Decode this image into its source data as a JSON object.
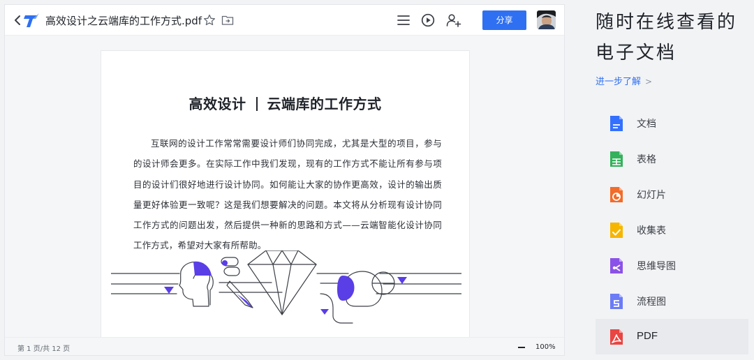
{
  "viewer": {
    "title": "高效设计之云端库的工作方式.pdf",
    "share_label": "分享",
    "icons": [
      "back-icon",
      "app-logo",
      "star-icon",
      "move-to-folder-icon",
      "menu-icon",
      "play-icon",
      "add-user-icon"
    ]
  },
  "document": {
    "heading_left": "高效设计",
    "heading_right": "云端库的工作方式",
    "body": "互联网的设计工作常常需要设计师们协同完成，尤其是大型的项目，参与的设计师会更多。在实际工作中我们发现，现有的工作方式不能让所有参与项目的设计们很好地进行设计协同。如何能让大家的协作更高效，设计的输出质量更好体验更一致呢？这是我们想要解决的问题。本文将从分析现有设计协同工作方式的问题出发，然后提供一种新的思路和方式——云端智能化设计协同工作方式，希望对大家有所帮助。"
  },
  "status": {
    "page_indicator": "第 1 页/共 12 页",
    "zoom": "100%"
  },
  "promo": {
    "title": "随时在线查看的电子文档",
    "learn_more": "进一步了解",
    "learn_more_chevron": ">"
  },
  "file_types": [
    {
      "label": "文档",
      "icon": "doc-icon",
      "color": "#3370ff"
    },
    {
      "label": "表格",
      "icon": "sheet-icon",
      "color": "#34b15c"
    },
    {
      "label": "幻灯片",
      "icon": "slides-icon",
      "color": "#f26c2a"
    },
    {
      "label": "收集表",
      "icon": "form-icon",
      "color": "#f6b600"
    },
    {
      "label": "思维导图",
      "icon": "mindmap-icon",
      "color": "#8a52e8"
    },
    {
      "label": "流程图",
      "icon": "flowchart-icon",
      "color": "#6b7cf6"
    },
    {
      "label": "PDF",
      "icon": "pdf-icon",
      "color": "#e84543",
      "active": true
    }
  ],
  "colors": {
    "accent": "#2f70f2",
    "illustration_accent": "#5a3ee6"
  }
}
